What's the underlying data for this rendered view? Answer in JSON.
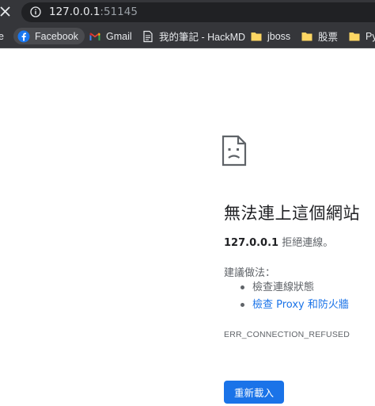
{
  "address_bar": {
    "url_host": "127.0.0.1",
    "url_port": ":51145",
    "info_icon": "info-icon",
    "close_icon": "close-icon"
  },
  "bookmarks": [
    {
      "label": "e",
      "icon": "none"
    },
    {
      "label": "Facebook",
      "icon": "facebook-icon"
    },
    {
      "label": "Gmail",
      "icon": "gmail-icon"
    },
    {
      "label": "我的筆記 - HackMD",
      "icon": "page-icon"
    },
    {
      "label": "jboss",
      "icon": "folder-icon"
    },
    {
      "label": "股票",
      "icon": "folder-icon"
    },
    {
      "label": "Py",
      "icon": "folder-icon"
    }
  ],
  "error": {
    "icon": "sad-page-icon",
    "title": "無法連上這個網站",
    "host": "127.0.0.1",
    "summary": " 拒絕連線。",
    "suggestions_label": "建議做法：",
    "suggestions": [
      {
        "label": "檢查連線狀態",
        "link": false
      },
      {
        "label": "檢查 Proxy 和防火牆",
        "link": true
      }
    ],
    "code": "ERR_CONNECTION_REFUSED",
    "reload_label": "重新載入"
  },
  "colors": {
    "chrome_dark": "#35363a",
    "omnibox": "#202124",
    "link": "#1a73e8",
    "button": "#1a73e8",
    "secondary_text": "#5f6368"
  }
}
